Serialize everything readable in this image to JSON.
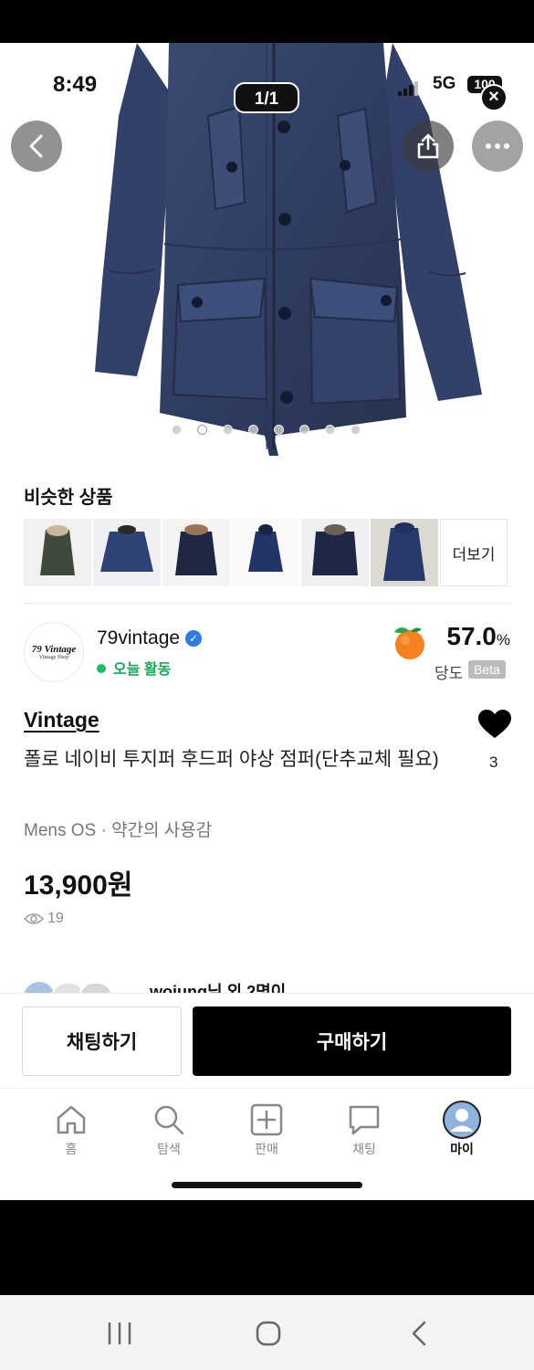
{
  "status": {
    "time": "8:49",
    "network": "5G",
    "battery": "100"
  },
  "photo": {
    "counter": "1/1",
    "page_dots": 8,
    "active_dot": 1
  },
  "similar": {
    "title": "비슷한 상품",
    "more_label": "더보기"
  },
  "seller": {
    "logo_line1": "79 Vintage",
    "logo_line2": "Vintage Shop",
    "name": "79vintage",
    "activity": "오늘 활동",
    "sweetness_value": "57.0",
    "sweetness_unit": "%",
    "sweetness_label": "당도",
    "beta_label": "Beta"
  },
  "product": {
    "brand": "Vintage",
    "title": "폴로 네이비 투지퍼 후드퍼 야상 점퍼(단추교체 필요)",
    "meta": "Mens OS · 약간의 사용감",
    "price": "13,900원",
    "views": "19",
    "likes": "3",
    "bidders_text": "woiung님 외 2명이"
  },
  "actions": {
    "chat_label": "채팅하기",
    "buy_label": "구매하기"
  },
  "tabbar": {
    "items": [
      {
        "label": "홈",
        "icon": "home-icon"
      },
      {
        "label": "탐색",
        "icon": "search-icon"
      },
      {
        "label": "판매",
        "icon": "plus-square-icon"
      },
      {
        "label": "채팅",
        "icon": "chat-bubble-icon"
      },
      {
        "label": "마이",
        "icon": "avatar-icon"
      }
    ],
    "active_index": 4
  },
  "colors": {
    "accent": "#000000",
    "active_green": "#1aa75a",
    "verified_blue": "#2f7de1",
    "peach": "#f5821f",
    "jacket_navy": "#34436a"
  }
}
